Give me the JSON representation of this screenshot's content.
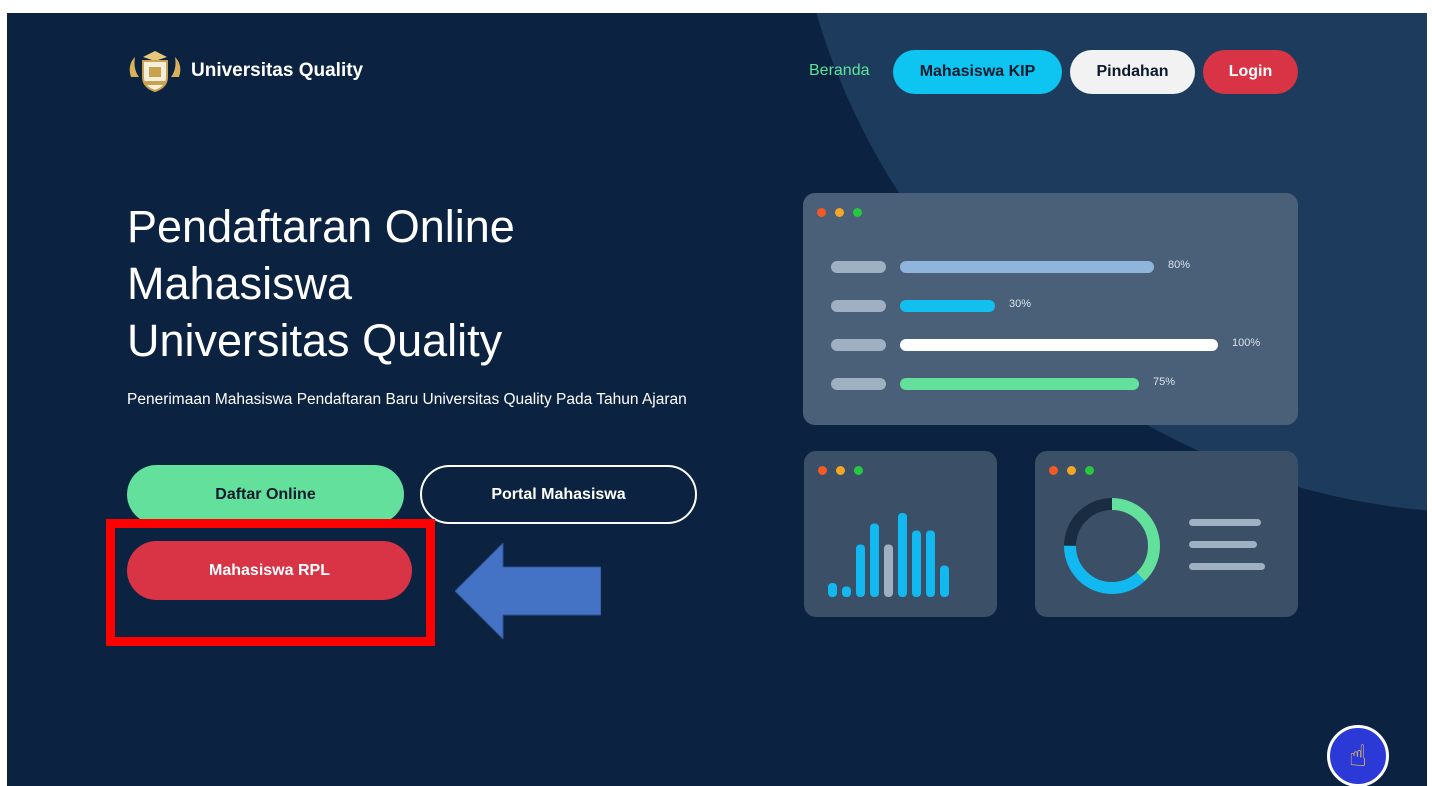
{
  "header": {
    "brand_name": "Universitas Quality",
    "logo_icon": "university-crest-logo",
    "nav": {
      "beranda": "Beranda",
      "kip": "Mahasiswa KIP",
      "pindahan": "Pindahan",
      "login": "Login"
    }
  },
  "hero": {
    "title_lines": [
      "Pendaftaran Online",
      "Mahasiswa",
      "Universitas Quality"
    ],
    "subtitle": "Penerimaan Mahasiswa Pendaftaran Baru Universitas Quality Pada Tahun Ajaran",
    "buttons": {
      "daftar": "Daftar Online",
      "portal": "Portal Mahasiswa",
      "rpl": "Mahasiswa RPL"
    }
  },
  "illustration": {
    "progress": [
      {
        "value": 80,
        "label": "80%",
        "color": "#8fb5dc"
      },
      {
        "value": 30,
        "label": "30%",
        "color": "#12c0f0"
      },
      {
        "value": 100,
        "label": "100%",
        "color": "#ffffff"
      },
      {
        "value": 75,
        "label": "75%",
        "color": "#62e09c"
      }
    ],
    "bar_chart": {
      "values": [
        2,
        1.5,
        7.5,
        10.5,
        7.5,
        12,
        9.5,
        9.5,
        4.5
      ],
      "colors": [
        "#12b8f0",
        "#12b8f0",
        "#12b8f0",
        "#12b8f0",
        "#9fb0c2",
        "#12b8f0",
        "#12b8f0",
        "#12b8f0",
        "#12b8f0"
      ]
    },
    "donut": {
      "segments": [
        {
          "value": 38,
          "color": "#62e09c"
        },
        {
          "value": 37,
          "color": "#12b8f0"
        },
        {
          "value": 25,
          "color": "#1a2c42"
        }
      ]
    }
  },
  "annotations": {
    "highlight_color": "#ff0000",
    "arrow_color": "#4472c4"
  },
  "fab": {
    "icon": "pointing-hand-icon",
    "glyph": "☝"
  }
}
